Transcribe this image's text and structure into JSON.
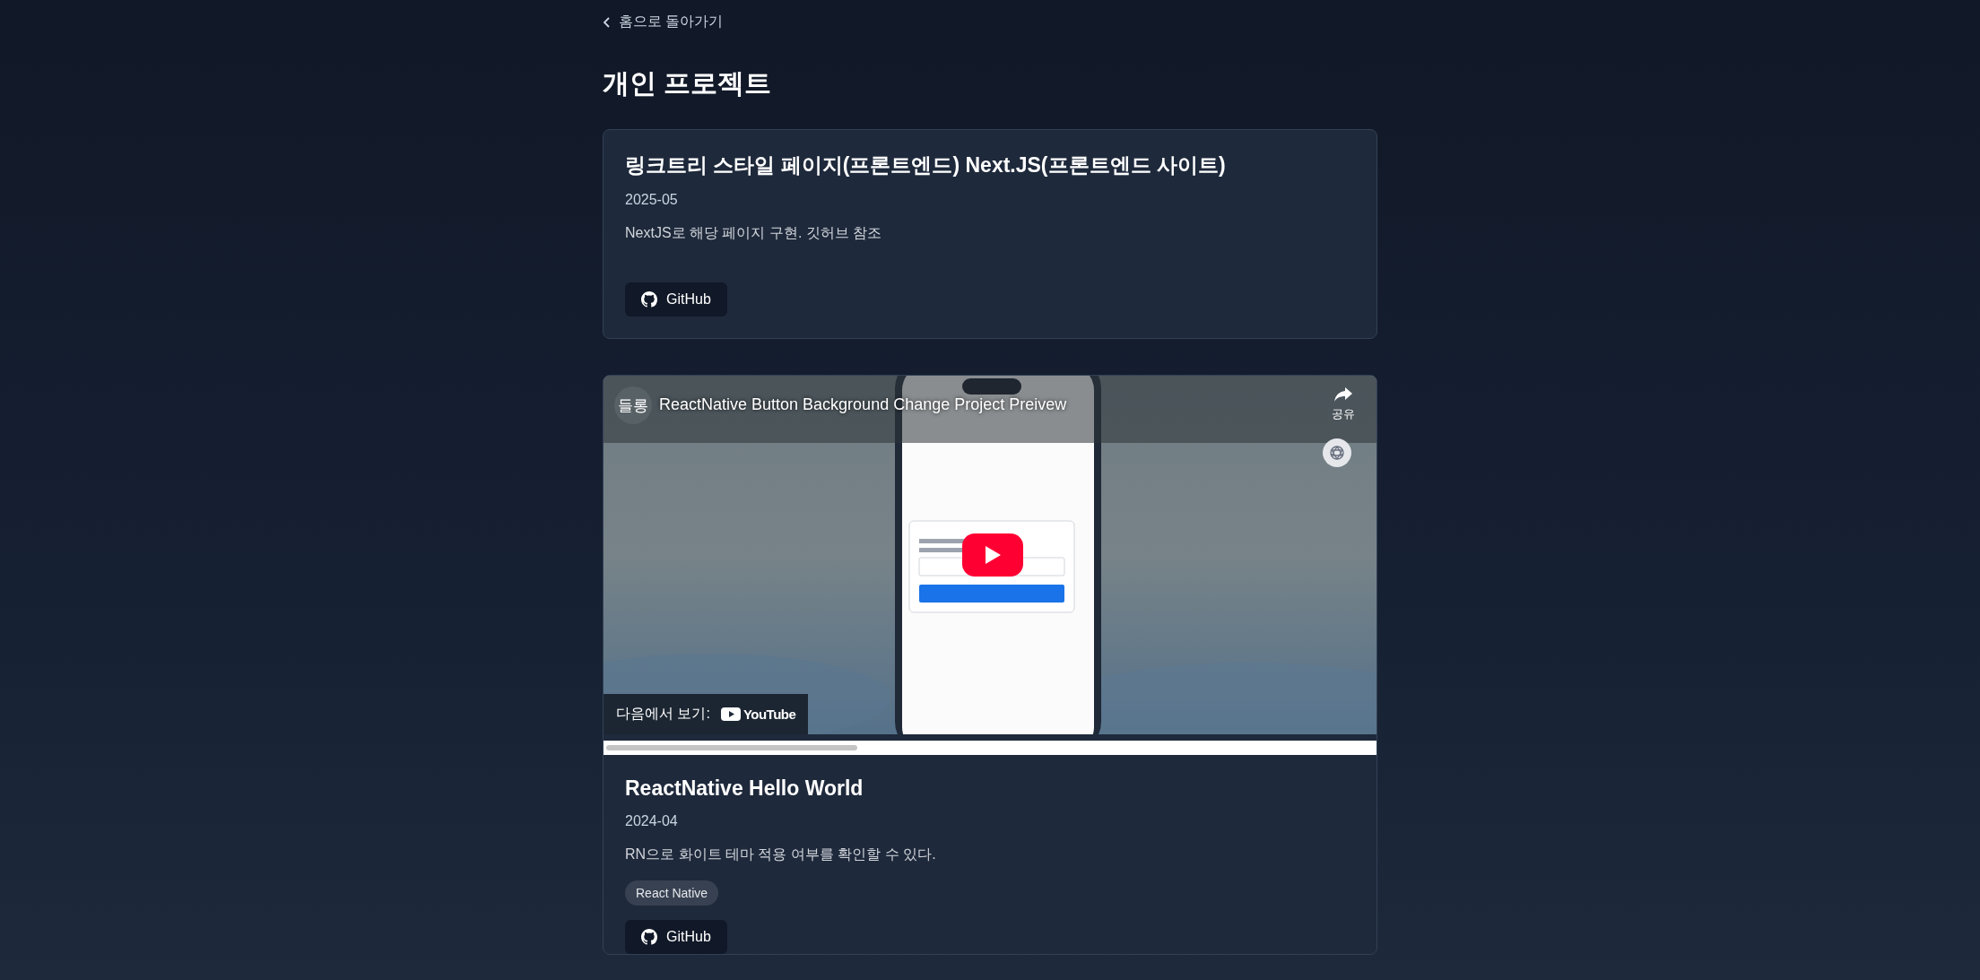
{
  "back_link": {
    "label": "홈으로 돌아가기"
  },
  "page_title": "개인 프로젝트",
  "projects": [
    {
      "kind": "text",
      "title": "링크트리 스타일 페이지(프론트엔드) Next.JS(프론트엔드 사이트)",
      "date": "2025-05",
      "description": "NextJS로 해당 페이지 구현. 깃허브 참조",
      "links": [
        "GitHub"
      ]
    },
    {
      "kind": "video",
      "video": {
        "channel_avatar": "들롱",
        "title": "ReactNative Button Background Change Project Preivew",
        "share_label": "공유",
        "watch_on": "다음에서 보기:",
        "watch_brand": "YouTube"
      },
      "title": "ReactNative Hello World",
      "date": "2024-04",
      "description": "RN으로 화이트 테마 적용 여부를 확인할 수 있다.",
      "tags": [
        "React Native"
      ],
      "links": [
        "GitHub"
      ]
    }
  ]
}
